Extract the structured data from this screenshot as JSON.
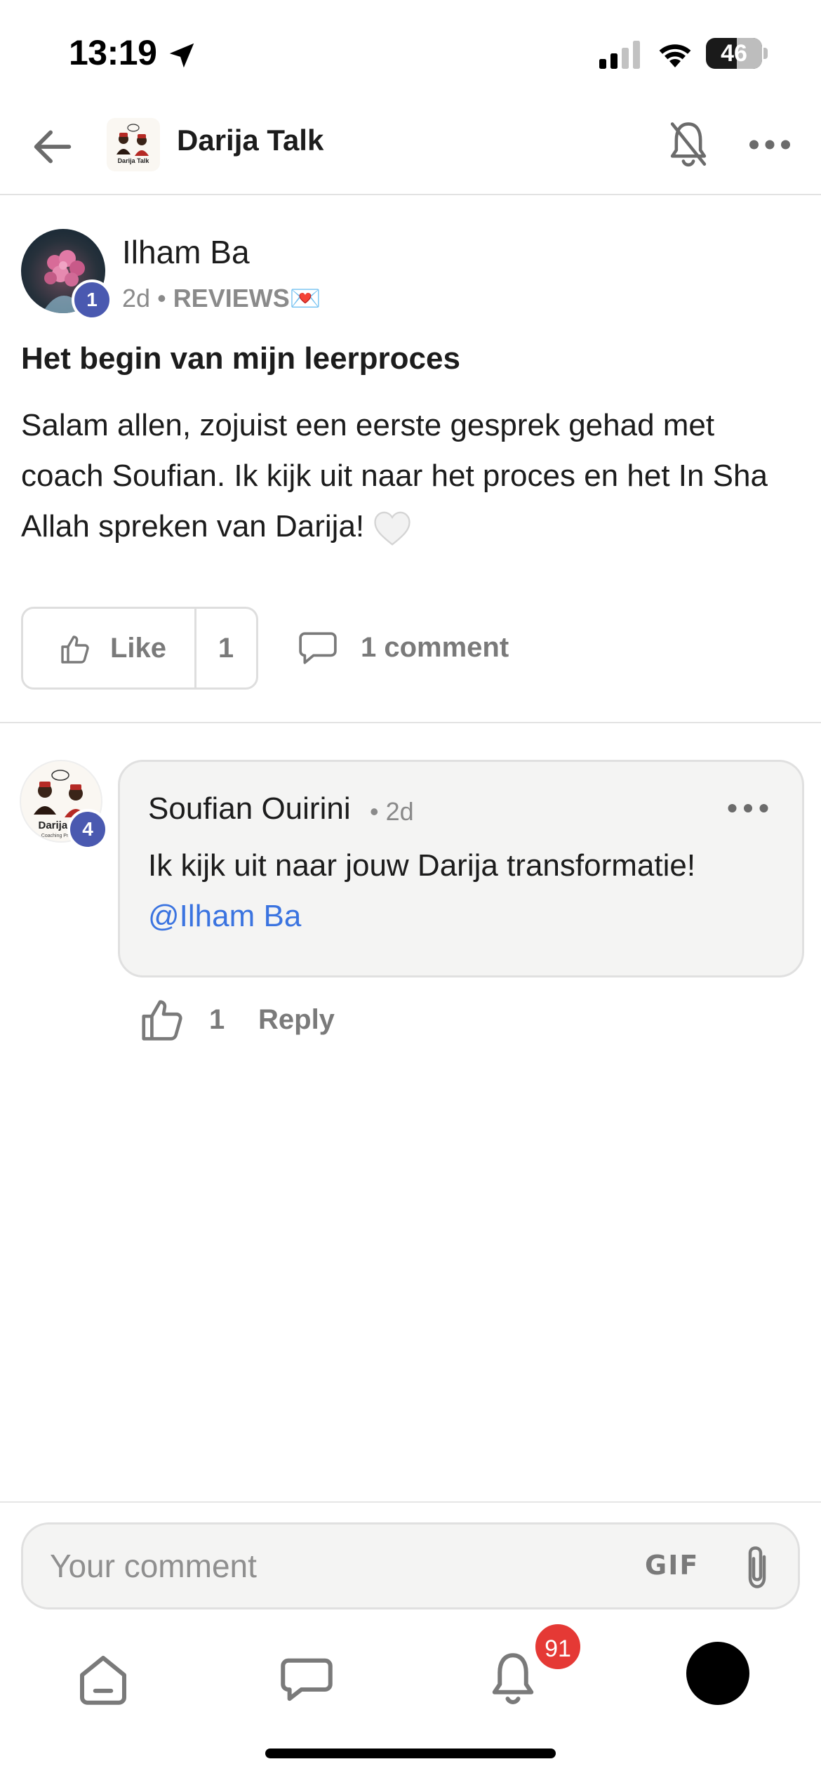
{
  "status_bar": {
    "time": "13:19",
    "battery": "46"
  },
  "header": {
    "group_name": "Darija Talk",
    "logo_text": "Darija Talk"
  },
  "post": {
    "author": "Ilham Ba",
    "author_level": "1",
    "age": "2d",
    "separator": "•",
    "category": "REVIEWS",
    "category_emoji": "💌",
    "title": "Het begin van mijn leerproces",
    "body": "Salam allen, zojuist een eerste gesprek gehad met coach Soufian. Ik kijk uit naar het proces en het In Sha Allah spreken van Darija!",
    "body_emoji": "white-heart",
    "like_label": "Like",
    "like_count": "1",
    "comment_count_label": "1 comment"
  },
  "comment": {
    "author": "Soufian Ouirini",
    "author_level": "4",
    "time": "• 2d",
    "text": "Ik kijk uit naar jouw Darija transformatie!",
    "mention": "@Ilham Ba",
    "like_count": "1",
    "reply_label": "Reply"
  },
  "composer": {
    "placeholder": "Your comment",
    "gif_label": "GIF"
  },
  "bottom_nav": {
    "notification_count": "91"
  },
  "colors": {
    "accent_blue": "#4a59b0",
    "mention_blue": "#3b74e0",
    "notification_red": "#e53935"
  }
}
